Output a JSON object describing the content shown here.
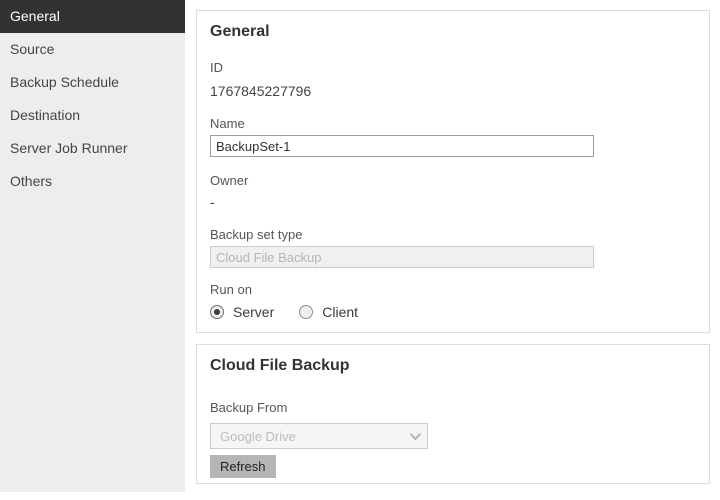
{
  "sidebar": {
    "items": [
      {
        "label": "General",
        "active": true
      },
      {
        "label": "Source",
        "active": false
      },
      {
        "label": "Backup Schedule",
        "active": false
      },
      {
        "label": "Destination",
        "active": false
      },
      {
        "label": "Server Job Runner",
        "active": false
      },
      {
        "label": "Others",
        "active": false
      }
    ]
  },
  "general_panel": {
    "title": "General",
    "id_label": "ID",
    "id_value": "1767845227796",
    "name_label": "Name",
    "name_value": "BackupSet-1",
    "owner_label": "Owner",
    "owner_value": "-",
    "backup_set_type_label": "Backup set type",
    "backup_set_type_value": "Cloud File Backup",
    "run_on_label": "Run on",
    "run_on_options": [
      {
        "label": "Server",
        "selected": true
      },
      {
        "label": "Client",
        "selected": false
      }
    ]
  },
  "cloud_panel": {
    "title": "Cloud File Backup",
    "backup_from_label": "Backup From",
    "backup_from_value": "Google Drive",
    "refresh_label": "Refresh"
  },
  "colors": {
    "sidebar_bg": "#ededed",
    "sidebar_active_bg": "#323232",
    "panel_border": "#dddddd",
    "disabled_field_bg": "#f0f0f0",
    "disabled_text": "#b5b5b5",
    "button_bg": "#b5b5b5"
  }
}
